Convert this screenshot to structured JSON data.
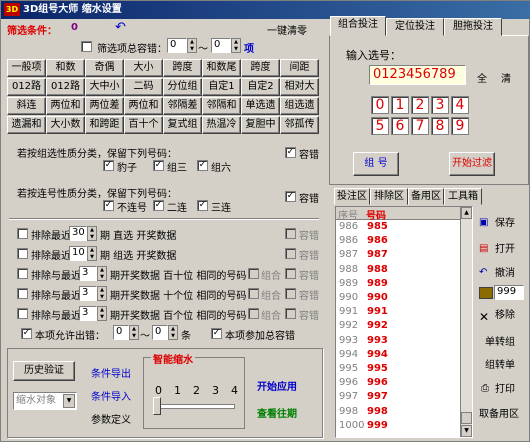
{
  "title": "3D组号大师 缩水设置",
  "header": {
    "filter_label": "筛选条件：",
    "filter_count": "0",
    "undo_icon": "↶",
    "clear_all": "一键清零",
    "tolerance_label": "筛选项总容错：",
    "tolerance_min": "0",
    "tolerance_sep": "～",
    "tolerance_max": "0",
    "tolerance_unit": "项"
  },
  "grid_buttons": [
    [
      "一般项",
      "和数",
      "奇偶",
      "大小",
      "跨度",
      "和数尾",
      "跨度",
      "间距"
    ],
    [
      "012路",
      "012路",
      "大中小",
      "二码",
      "分位组",
      "自定1",
      "自定2",
      "相对大"
    ],
    [
      "斜连",
      "两位和",
      "两位差",
      "两位和",
      "邻隔差",
      "邻隔和",
      "单选遗",
      "组选遗"
    ],
    [
      "遗漏和",
      "大小数",
      "和跨距",
      "百十个",
      "复式组",
      "热温冷",
      "复胆中",
      "邻孤传"
    ]
  ],
  "section1": {
    "label": "若按组选性质分类，保留下列号码：",
    "opt1": "豹子",
    "opt2": "组三",
    "opt3": "组六",
    "err": "容错"
  },
  "section2": {
    "label": "若按连号性质分类，保留下列号码：",
    "opt1": "不连号",
    "opt2": "二连",
    "opt3": "三连",
    "err": "容错"
  },
  "excludes": [
    {
      "pre": "排除最近",
      "val": "30",
      "post": "期  直选  开奖数据",
      "err": "容错"
    },
    {
      "pre": "排除最近",
      "val": "10",
      "post": "期  组选  开奖数据",
      "err": "容错"
    },
    {
      "pre": "排除与最近",
      "val": "3",
      "post": "期开奖数据  百十位  相同的号码",
      "combo": "组合",
      "err": "容错"
    },
    {
      "pre": "排除与最近",
      "val": "3",
      "post": "期开奖数据  十个位  相同的号码",
      "combo": "组合",
      "err": "容错"
    },
    {
      "pre": "排除与最近",
      "val": "3",
      "post": "期开奖数据  百个位  相同的号码",
      "combo": "组合",
      "err": "容错"
    }
  ],
  "allow": {
    "label": "本项允许出错：",
    "min": "0",
    "sep": "～",
    "max": "0",
    "unit": "条",
    "total_label": "本项参加总容错"
  },
  "bottom": {
    "history_btn": "历史验证",
    "shrink_select": "缩水对象",
    "export": "条件导出",
    "import": "条件导入",
    "params": "参数定义",
    "smart_title": "智能缩水",
    "scale": [
      "0",
      "1",
      "2",
      "3",
      "4"
    ],
    "apply": "开始应用",
    "check": "查看往期"
  },
  "right": {
    "tabs": [
      "组合投注",
      "定位投注",
      "胆拖投注"
    ],
    "input_label": "输入选号：",
    "input_value": "0123456789",
    "all_btn": "全",
    "clear_btn": "清",
    "digits_row1": [
      "0",
      "1",
      "2",
      "3",
      "4"
    ],
    "digits_row2": [
      "5",
      "6",
      "7",
      "8",
      "9"
    ],
    "group_btn": "组 号",
    "filter_btn": "开始过滤",
    "sub_tabs": [
      "投注区",
      "排除区",
      "备用区",
      "工具箱"
    ],
    "list_headers": [
      "序号",
      "号码"
    ],
    "rows": [
      {
        "n": "986",
        "c": "985"
      },
      {
        "n": "986",
        "c": "986"
      },
      {
        "n": "987",
        "c": "987"
      },
      {
        "n": "988",
        "c": "988"
      },
      {
        "n": "989",
        "c": "989"
      },
      {
        "n": "990",
        "c": "990"
      },
      {
        "n": "991",
        "c": "991"
      },
      {
        "n": "992",
        "c": "992"
      },
      {
        "n": "993",
        "c": "993"
      },
      {
        "n": "994",
        "c": "994"
      },
      {
        "n": "995",
        "c": "995"
      },
      {
        "n": "996",
        "c": "996"
      },
      {
        "n": "997",
        "c": "997"
      },
      {
        "n": "998",
        "c": "998"
      },
      {
        "n": "1000",
        "c": "999"
      }
    ],
    "side": {
      "save": "保存",
      "open": "打开",
      "undo": "撤消",
      "count": "999",
      "remove": "移除",
      "single_group": "单转组",
      "group_single": "组转单",
      "print": "打印",
      "take_spare": "取备用区"
    }
  }
}
